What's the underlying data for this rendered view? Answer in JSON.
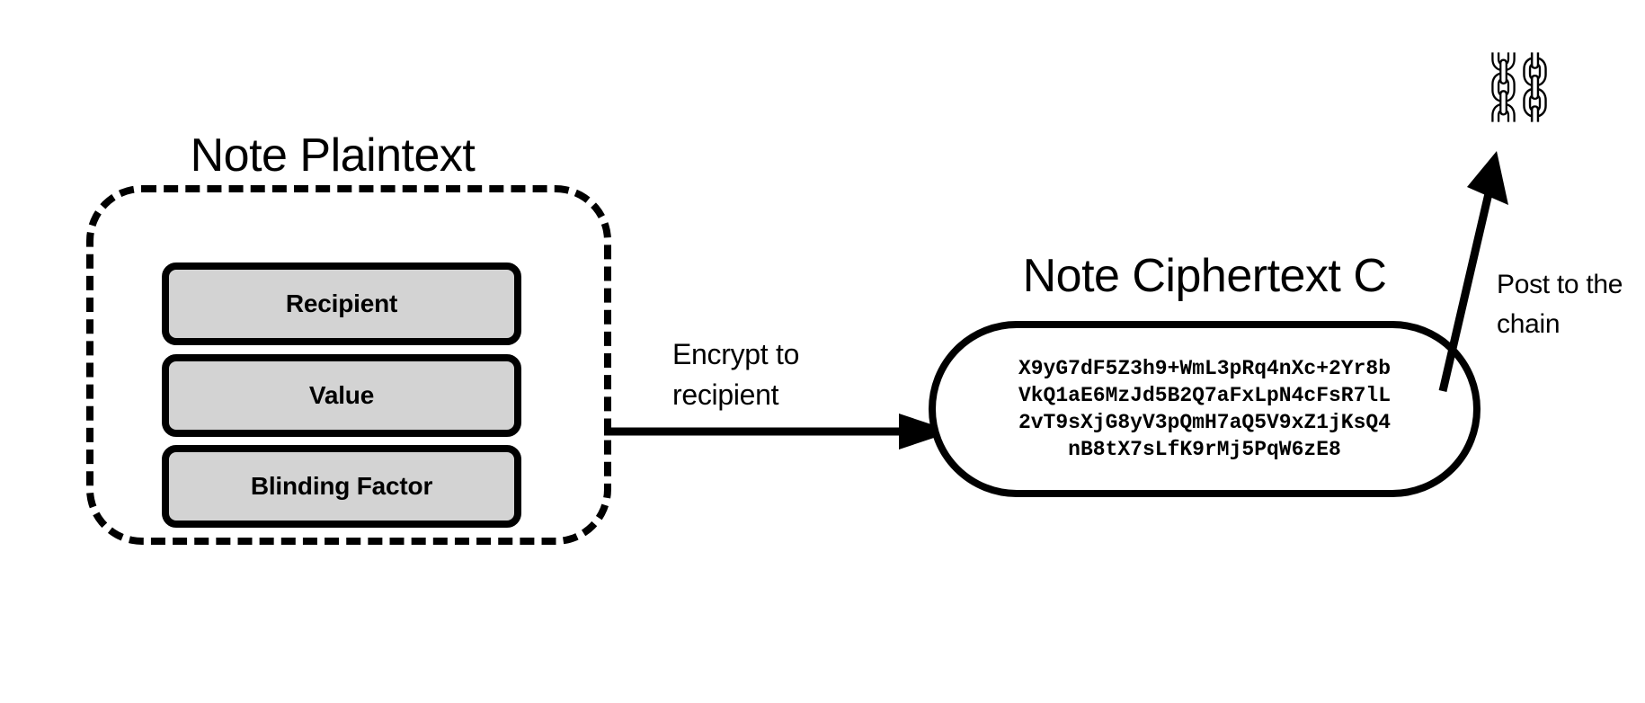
{
  "diagram": {
    "background_color": "#ffffff",
    "stroke_color": "#000000",
    "box_fill_color": "#d3d3d3",
    "plaintext": {
      "title": "Note Plaintext",
      "container_style": "dashed-rounded-rect",
      "fields": [
        {
          "label": "Recipient"
        },
        {
          "label": "Value"
        },
        {
          "label": "Blinding Factor"
        }
      ]
    },
    "encrypt_step": {
      "label_line1": "Encrypt to",
      "label_line2": "recipient",
      "arrow": "right-arrow"
    },
    "ciphertext": {
      "title": "Note Ciphertext C",
      "container_style": "solid-pill",
      "body_lines": [
        "X9yG7dF5Z3h9+WmL3pRq4nXc+2Yr8b",
        "VkQ1aE6MzJd5B2Q7aFxLpN4cFsR7lL",
        "2vT9sXjG8yV3pQmH7aQ5V9xZ1jKsQ4",
        "nB8tX7sLfK9rMj5PqW6zE8"
      ],
      "body_text": "X9yG7dF5Z3h9+WmL3pRq4nXc+2Yr8b\nVkQ1aE6MzJd5B2Q7aFxLpN4cFsR7lL\n2vT9sXjG8yV3pQmH7aQ5V9xZ1jKsQ4\nnB8tX7sLfK9rMj5PqW6zE8"
    },
    "post_step": {
      "label_line1": "Post to the",
      "label_line2": "chain",
      "arrow": "diagonal-up-right-arrow",
      "icon_glyph": "⛓",
      "icon_name": "chains-icon"
    }
  }
}
